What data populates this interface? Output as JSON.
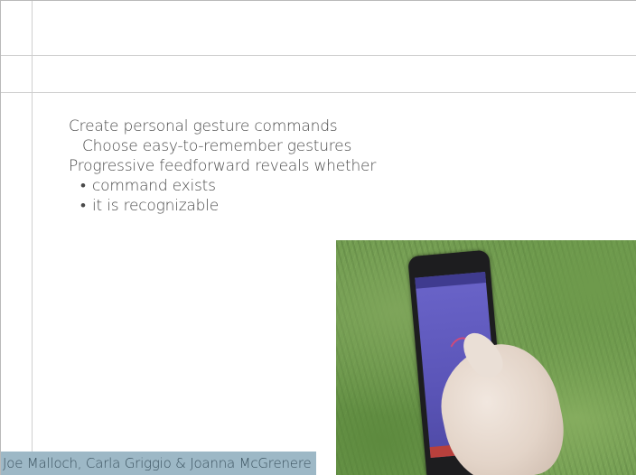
{
  "slide": {
    "bullets": [
      {
        "level": 1,
        "text": "Create personal gesture commands"
      },
      {
        "level": 2,
        "text": "Choose easy-to-remember gestures"
      },
      {
        "level": 1,
        "text": "Progressive feedforward reveals whether"
      },
      {
        "level": 3,
        "text": "command exists"
      },
      {
        "level": 3,
        "text": "it is recognizable"
      }
    ],
    "bullet_glyph": "•",
    "photo_alt": "Hand holding a smartphone over grass",
    "credit": "Joe Malloch, Carla Griggio & Joanna McGrenere"
  },
  "colors": {
    "text": "#4a4a4a",
    "rule_lines": "#cfcfcf",
    "credit_background": "#9db8c6",
    "credit_text": "#3c5360",
    "phone_screen": "#5b55b8",
    "grass": "#6f9a4f"
  }
}
